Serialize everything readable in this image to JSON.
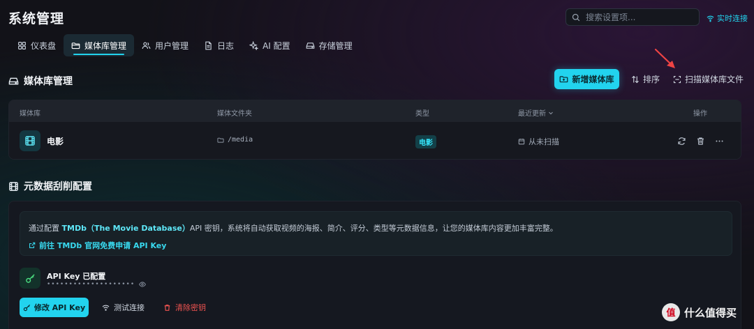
{
  "app": {
    "title": "系统管理"
  },
  "search": {
    "placeholder": "搜索设置项..."
  },
  "status": {
    "label": "实时连接",
    "icon": "wifi-icon"
  },
  "tabs": [
    {
      "label": "仪表盘",
      "icon": "grid-icon",
      "active": false
    },
    {
      "label": "媒体库管理",
      "icon": "folder-icon",
      "active": true
    },
    {
      "label": "用户管理",
      "icon": "users-icon",
      "active": false
    },
    {
      "label": "日志",
      "icon": "file-icon",
      "active": false
    },
    {
      "label": "AI 配置",
      "icon": "sparkle-icon",
      "active": false
    },
    {
      "label": "存储管理",
      "icon": "drive-icon",
      "active": false
    }
  ],
  "library": {
    "title": "媒体库管理",
    "actions": {
      "add": "新增媒体库",
      "sort": "排序",
      "scan": "扫描媒体库文件"
    },
    "columns": {
      "name": "媒体库",
      "folder": "媒体文件夹",
      "type": "类型",
      "updated": "最近更新",
      "actions": "操作"
    },
    "rows": [
      {
        "name": "电影",
        "path": "/media",
        "type": "电影",
        "updated": "从未扫描"
      }
    ]
  },
  "metadata": {
    "title": "元数据刮削配置",
    "info_prefix": "通过配置 ",
    "info_highlight": "TMDb（The Movie Database）",
    "info_suffix": "API 密钥，系统将自动获取视频的海报、简介、评分、类型等元数据信息，让您的媒体库内容更加丰富完整。",
    "link": "前往 TMDb 官网免费申请 API Key",
    "key_title": "API Key 已配置",
    "key_mask": "••••••••••••••••••••",
    "buttons": {
      "edit": "修改 API Key",
      "test": "测试连接",
      "clear": "清除密钥"
    }
  },
  "watermark": {
    "logo": "值",
    "text": "什么值得买"
  },
  "colors": {
    "accent": "#22d3ee",
    "danger": "#ef5350",
    "background": "#121218"
  }
}
